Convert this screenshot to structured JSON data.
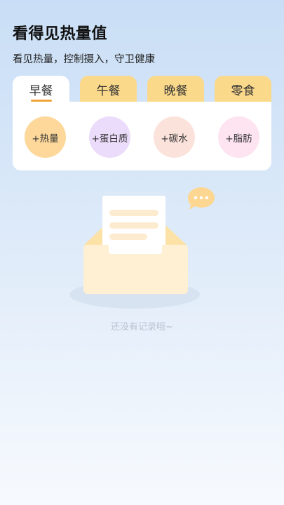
{
  "header": {
    "title": "看得见热量值",
    "subtitle": "看见热量，控制摄入，守卫健康"
  },
  "tabs": [
    {
      "label": "早餐",
      "active": true
    },
    {
      "label": "午餐",
      "active": false
    },
    {
      "label": "晚餐",
      "active": false
    },
    {
      "label": "零食",
      "active": false
    }
  ],
  "quick_add": [
    {
      "label": "+热量",
      "color": "#fdd89a"
    },
    {
      "label": "+蛋白质",
      "color": "#ecdcfb"
    },
    {
      "label": "+碳水",
      "color": "#fbe3db"
    },
    {
      "label": "+脂肪",
      "color": "#fde4f0"
    }
  ],
  "empty_state": {
    "message": "还没有记录哦~",
    "icon": "empty-envelope-icon"
  },
  "colors": {
    "tab_inactive": "#fbd98a",
    "tab_indicator": "#f0a43a"
  }
}
